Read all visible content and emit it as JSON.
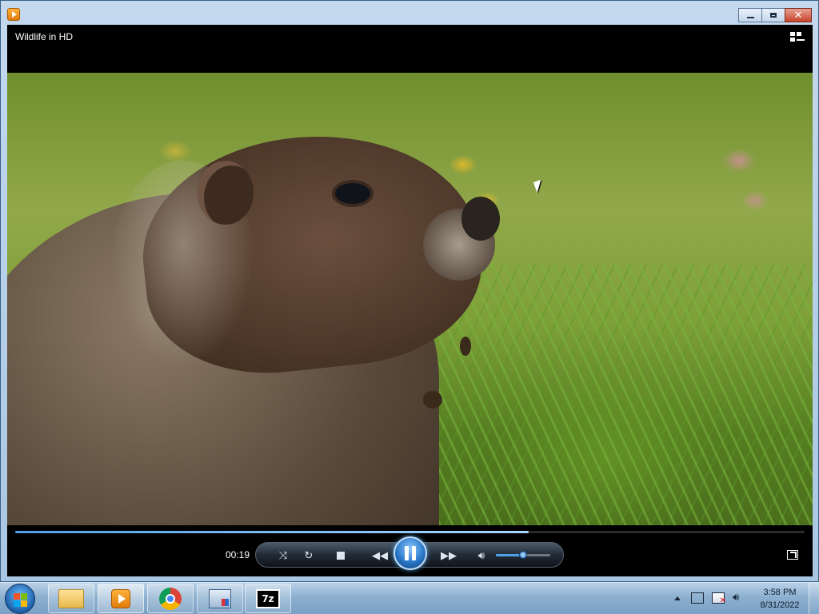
{
  "window": {
    "app_icon": "windows-media-player-icon",
    "buttons": [
      "minimize-icon",
      "maximize-icon",
      "close-icon"
    ],
    "close_glyph": "✕"
  },
  "player": {
    "title": "Wildlife in HD",
    "switch_to_library_icon": "switch-to-library-icon",
    "elapsed": "00:19",
    "seek_progress": 0.65,
    "volume_level": 0.5,
    "accent_color": "#4ea0e8",
    "controls": [
      "shuffle-icon",
      "repeat-icon",
      "stop-icon",
      "previous-icon",
      "pause-icon",
      "next-icon",
      "volume-icon"
    ],
    "fullscreen_icon": "full-screen-icon"
  },
  "taskbar": {
    "start_icon": "windows-start-icon",
    "items": [
      "file-explorer",
      "windows-media-player",
      "google-chrome",
      "network-app",
      "7-zip"
    ],
    "sevenzip_label": "7z",
    "tray_icons": [
      "show-hidden-icons-arrow",
      "network-icon",
      "action-center-icon",
      "volume-icon"
    ],
    "time": "3:58 PM",
    "date": "8/31/2022"
  }
}
